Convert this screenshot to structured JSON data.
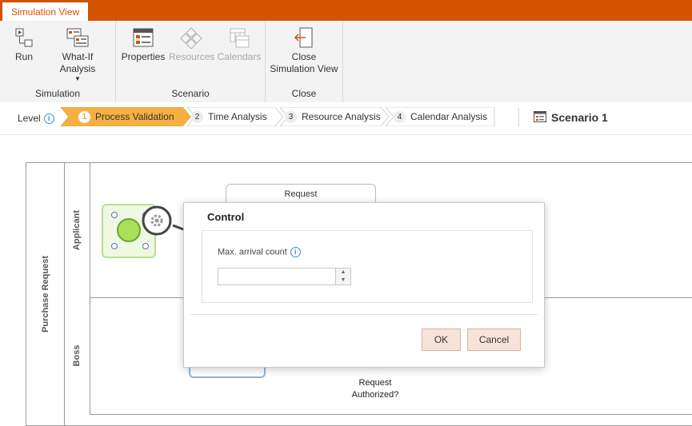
{
  "tab": {
    "label": "Simulation View"
  },
  "ribbon": {
    "groups": [
      {
        "label": "Simulation",
        "buttons": [
          {
            "label": "Run"
          },
          {
            "label": "What-If Analysis"
          }
        ]
      },
      {
        "label": "Scenario",
        "buttons": [
          {
            "label": "Properties"
          },
          {
            "label": "Resources"
          },
          {
            "label": "Calendars"
          }
        ]
      },
      {
        "label": "Close",
        "buttons": [
          {
            "label": "Close Simulation View"
          }
        ]
      }
    ]
  },
  "levels": {
    "label": "Level",
    "steps": [
      {
        "num": "1",
        "label": "Process Validation",
        "active": true
      },
      {
        "num": "2",
        "label": "Time Analysis"
      },
      {
        "num": "3",
        "label": "Resource Analysis"
      },
      {
        "num": "4",
        "label": "Calendar Analysis"
      }
    ],
    "scenario": "Scenario 1"
  },
  "diagram": {
    "pool": "Purchase Request",
    "lanes": [
      "Applicant",
      "Boss"
    ],
    "task_label": "Request",
    "gateway_label": "Request Authorized?"
  },
  "dialog": {
    "title": "Control",
    "field_label": "Max. arrival count",
    "field_value": "",
    "ok": "OK",
    "cancel": "Cancel"
  },
  "colors": {
    "accent": "#d35400",
    "active_step": "#f6b042",
    "start_event": "#a8e05a",
    "button_bg": "#f7e3d8"
  }
}
